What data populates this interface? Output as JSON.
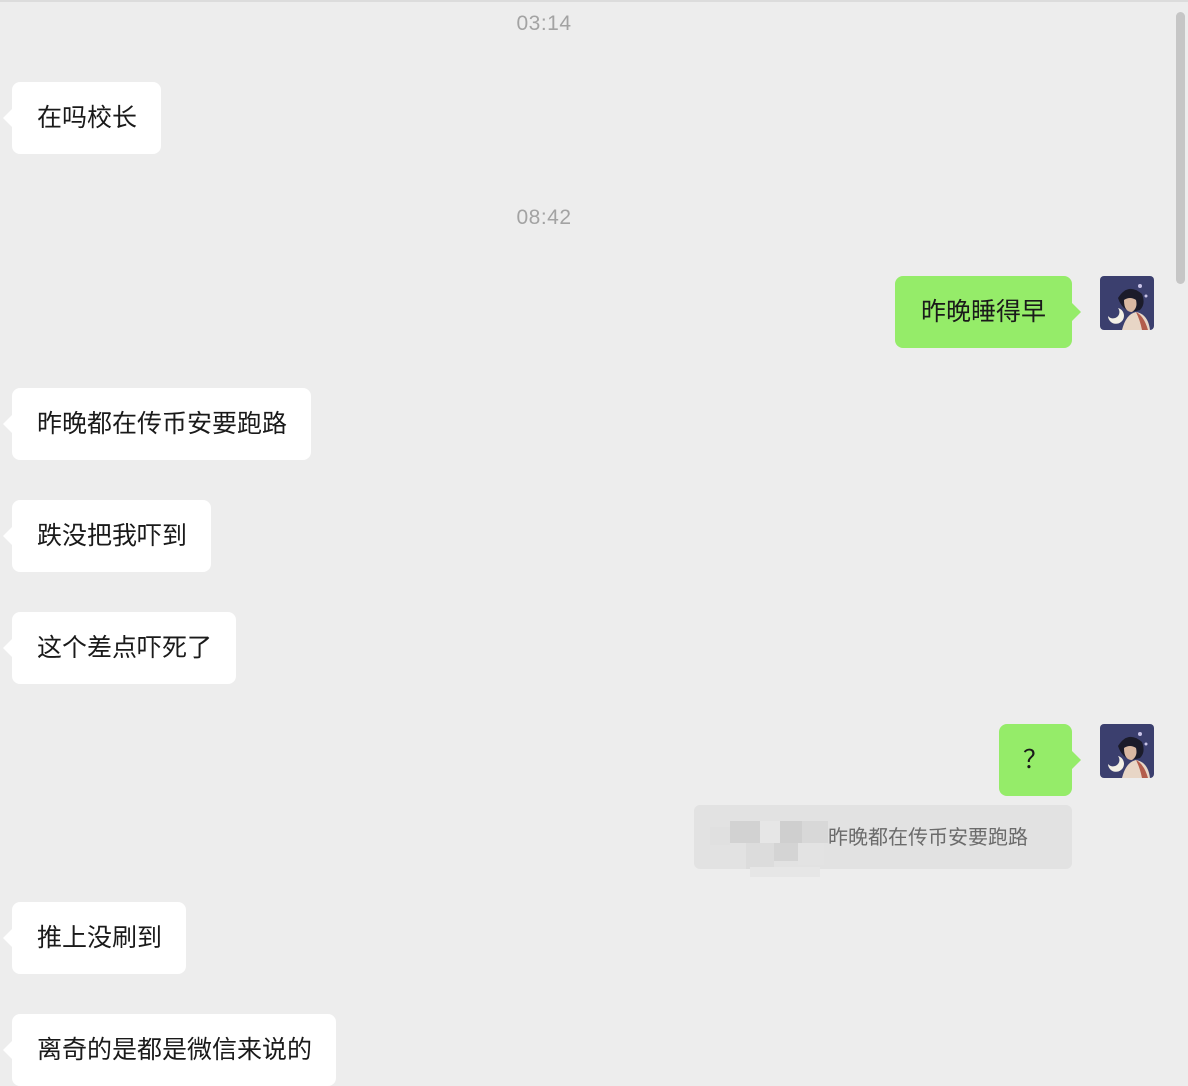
{
  "timestamps": {
    "first": "03:14",
    "second": "08:42"
  },
  "messages": {
    "m1": "在吗校长",
    "m2": "昨晚睡得早",
    "m3": "昨晚都在传币安要跑路",
    "m4": "跌没把我吓到",
    "m5": "这个差点吓死了",
    "m6": "？",
    "m7": "推上没刷到",
    "m8": "离奇的是都是微信来说的"
  },
  "quote": {
    "text": "昨晚都在传币安要跑路"
  },
  "colors": {
    "background": "#ededed",
    "incoming_bubble": "#ffffff",
    "outgoing_bubble": "#95ec69",
    "quote_bg": "#e2e2e2",
    "timestamp": "#a3a3a3"
  },
  "icons": {
    "self_avatar": "avatar-illustration-icon"
  }
}
